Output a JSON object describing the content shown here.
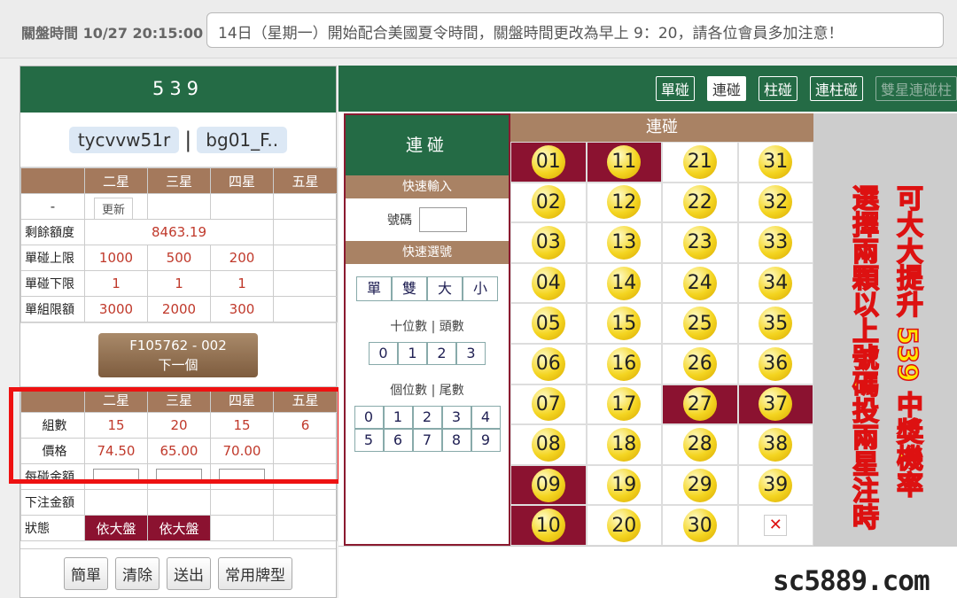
{
  "topbar": {
    "close_time_label": "關盤時間 10/27 20:15:00",
    "notice": "14日（星期一）開始配合美國夏令時間，關盤時間更改為早上 9：20，請各位會員多加注意！"
  },
  "left": {
    "game_title": "539",
    "user1": "tycvvw51r",
    "user_sep": "|",
    "user2": "bg01_F..",
    "headers": [
      "",
      "二星",
      "三星",
      "四星",
      "五星"
    ],
    "dash": "-",
    "update_label": "更新",
    "balance_label": "剩餘額度",
    "balance_value": "8463.19",
    "rows": [
      {
        "label": "單碰上限",
        "values": [
          "1000",
          "500",
          "200",
          ""
        ]
      },
      {
        "label": "單碰下限",
        "values": [
          "1",
          "1",
          "1",
          ""
        ]
      },
      {
        "label": "單組限額",
        "values": [
          "3000",
          "2000",
          "300",
          ""
        ]
      }
    ],
    "next_code": "F105762 - 002",
    "next_label": "下一個",
    "sum_headers": [
      "",
      "二星",
      "三星",
      "四星",
      "五星"
    ],
    "groups_label": "組數",
    "groups": [
      "15",
      "20",
      "15",
      "6"
    ],
    "price_label": "價格",
    "prices": [
      "74.50",
      "65.00",
      "70.00",
      ""
    ],
    "per_bet_label": "每碰金額",
    "bet_total_label": "下注金額",
    "status_label": "狀態",
    "status_values": [
      "依大盤",
      "依大盤",
      "",
      ""
    ],
    "buttons": [
      "簡單",
      "清除",
      "送出",
      "常用牌型"
    ]
  },
  "right": {
    "tabs": [
      {
        "label": "單碰",
        "state": "normal"
      },
      {
        "label": "連碰",
        "state": "active"
      },
      {
        "label": "柱碰",
        "state": "normal"
      },
      {
        "label": "連柱碰",
        "state": "normal"
      },
      {
        "label": "雙星連碰柱",
        "state": "disabled"
      }
    ],
    "quick": {
      "title": "連碰",
      "input_section": "快速輸入",
      "number_label": "號碼",
      "select_section": "快速選號",
      "odd_even": [
        "單",
        "雙",
        "大",
        "小"
      ],
      "tens_label": "十位數 | 頭數",
      "tens": [
        "0",
        "1",
        "2",
        "3"
      ],
      "units_label": "個位數 | 尾數",
      "units_row1": [
        "0",
        "1",
        "2",
        "3",
        "4"
      ],
      "units_row2": [
        "5",
        "6",
        "7",
        "8",
        "9"
      ]
    },
    "ball_title": "連碰",
    "selected_balls": [
      "01",
      "11",
      "27",
      "37",
      "09",
      "10"
    ],
    "promo_col1": "選擇兩顆以上號碼投兩星注時",
    "promo_col2": "可大大提升 539 中獎機率"
  },
  "watermark": "sc5889.com",
  "colors": {
    "green": "#246b45",
    "maroon": "#8b1230",
    "tan": "#a98264",
    "ball": "#f4d521",
    "highlight_box": "#ee1111"
  }
}
